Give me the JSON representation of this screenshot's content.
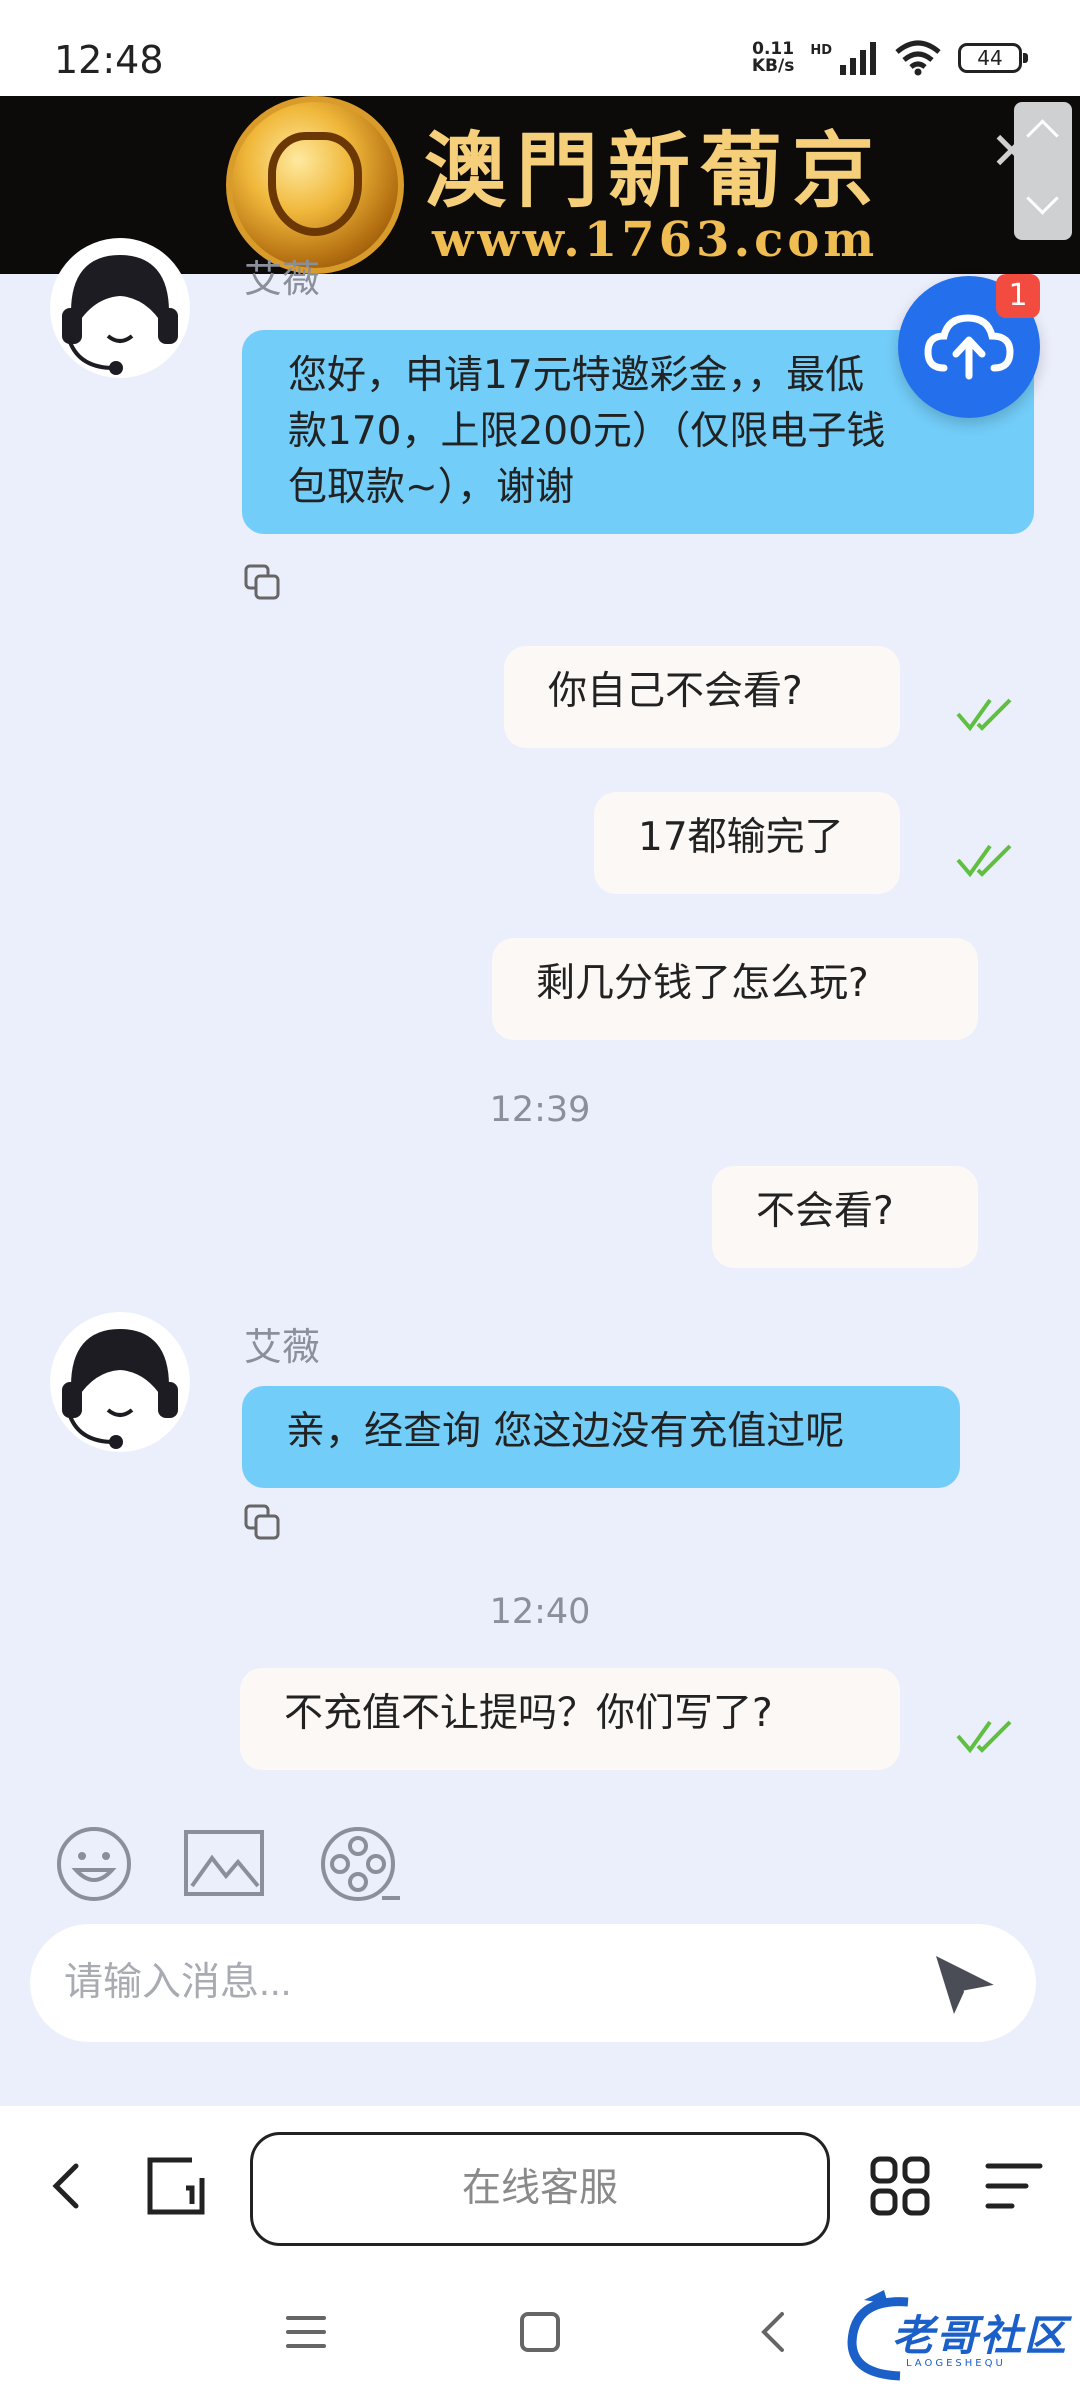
{
  "status_bar": {
    "time": "12:48",
    "net_speed_value": "0.11",
    "net_speed_unit": "KB/s",
    "hd_label": "HD",
    "battery_level": "44"
  },
  "ad": {
    "title": "澳門新葡京",
    "url": "www.1763.com",
    "close_glyph": "✕"
  },
  "chat": {
    "agent_name": "艾薇",
    "upload_badge_count": "1",
    "messages": [
      {
        "direction": "in",
        "sender": "艾薇",
        "text_line1": "您好，申请17元特邀彩金，，最低",
        "text_line2": "款170，上限200元）（仅限电子钱",
        "text_line3": "包取款~），谢谢"
      },
      {
        "direction": "out",
        "text": "你自己不会看?",
        "status": "read"
      },
      {
        "direction": "out",
        "text": "17都输完了",
        "status": "read"
      },
      {
        "direction": "out",
        "text": "剩几分钱了怎么玩?"
      },
      {
        "direction": "out",
        "text": "不会看?"
      },
      {
        "direction": "in",
        "sender": "艾薇",
        "text": "亲，经查询 您这边没有充值过呢"
      },
      {
        "direction": "out",
        "text": "不充值不让提吗？你们写了?",
        "status": "read"
      }
    ],
    "timestamps": [
      "12:39",
      "12:40"
    ]
  },
  "composer": {
    "placeholder": "请输入消息...",
    "tools": [
      "emoji-icon",
      "image-icon",
      "video-icon"
    ]
  },
  "browser_bar": {
    "title": "在线客服"
  },
  "watermark": {
    "text": "老哥社区",
    "subtext": "LAOGESHEQU"
  },
  "colors": {
    "chat_background": "#ebeefb",
    "incoming_bubble": "#72cdf8",
    "outgoing_bubble": "#fcf8f6",
    "read_check": "#5fbf3f",
    "upload_button": "#2470ec",
    "badge": "#f24b3f"
  }
}
